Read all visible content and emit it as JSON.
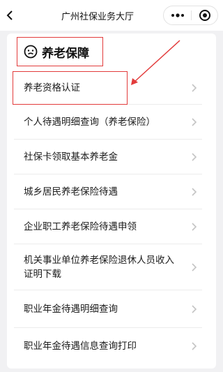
{
  "navbar": {
    "title": "广州社保业务大厅"
  },
  "section": {
    "title": "养老保障"
  },
  "menu": {
    "items": [
      {
        "label": "养老资格认证"
      },
      {
        "label": "个人待遇明细查询（养老保险）"
      },
      {
        "label": "社保卡领取基本养老金"
      },
      {
        "label": "城乡居民养老保险待遇"
      },
      {
        "label": "企业职工养老保险待遇申领"
      },
      {
        "label": "机关事业单位养老保险退休人员收入证明下载"
      },
      {
        "label": "职业年金待遇明细查询"
      },
      {
        "label": "职业年金待遇信息查询打印"
      }
    ]
  },
  "colors": {
    "annotation": "#e23b3b",
    "background": "#f1f1f3",
    "card": "#ffffff"
  },
  "icons": {
    "back": "chevron-left-icon",
    "more": "more-dots-icon",
    "close": "target-close-icon",
    "section": "face-icon",
    "row": "chevron-right-icon"
  }
}
